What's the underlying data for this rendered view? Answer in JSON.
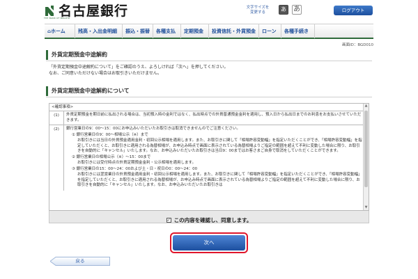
{
  "header": {
    "bank_name": "名古屋銀行",
    "bank_sub": "THE BANK OF NAGOYA",
    "font_size_label": "文字サイズを\n変更する",
    "font_small": "あ",
    "font_large": "あ",
    "logout_label": "ログアウト"
  },
  "nav": {
    "items": [
      {
        "label": "ホーム"
      },
      {
        "label": "残高・入出金明細"
      },
      {
        "label": "振込・振替"
      },
      {
        "label": "各種支払"
      },
      {
        "label": "定期預金"
      },
      {
        "label": "投資信託・外貨預金"
      },
      {
        "label": "ローン"
      },
      {
        "label": "各種手続き"
      }
    ]
  },
  "screen_id": "画面ID：BGD010",
  "page_title": "外貨定期預金中途解約",
  "intro": [
    "「外貨定期預金中途解約について」をご確認のうえ、よろしければ「次へ」を押してください。",
    "なお、ご同意いただけない場合はお取引きいただけません。"
  ],
  "section_title": "外貨定期預金中途解約について",
  "terms": {
    "caption": "<確認事項>",
    "item1_num": "(1)",
    "item1_text": "外貨定期預金を期日前に払出される場合は、当初預入時の金利ではなく、払出時点での外貨普通預金金利を適用し、預入日から払出日までのお利息をお支払いさせていただきます。",
    "item2_num": "(2)",
    "item2_lines": [
      "銀行営業日の9：00～15：00にお申込みいただいたお取引きは取消できませんのでご注意ください。",
      "① 銀行営業日の9：00～相場公示（※）まで",
      "お取引きには当日の外貨預金適用金利・初回公示相場を適用します。また、お取引きに関して「相場許容変動幅」を指定いただくことができ、「相場許容変動幅」を指定していただくと、お取引きに適用される為替相場が、お申込み時点で画面に表示されている為替相場よりご指定の範囲を超えて不利に変動した場合に限り、お取引きを自動的に「キャンセル」いたします。なお、お申込みいただいたお取引きは当日9：00まではお客さまご自身で取消をしていただくことができます。",
      "② 銀行営業日の相場公示（※）～15：00まで",
      "お取引きには受付時点の外貨定期預金金利・公示相場を適用します。",
      "③ 銀行営業日の15：00～24：00および土・日・祝日の0：00～24：00",
      "お取引きには翌営業日の外貨預金適用金利・初回公示相場を適用します。また、お取引きに関して「相場許容変動幅」を指定いただくことができ、「相場許容変動幅」を指定していただくと、お取引きに適用される為替相場が、お申込み時点で画面に表示されている為替相場よりご指定の範囲を超えて不利に変動した場合に限り、お取引きを自動的に「キャンセル」いたします。なお、お申込みいただいたお取引きは"
    ]
  },
  "confirm_label": "この内容を確認し、同意します。",
  "next_label": "次へ",
  "back_label": "戻る",
  "colors": {
    "brand_green": "#2f6b3a",
    "button_blue": "#1c4f9f",
    "highlight_red": "#e0162b"
  }
}
